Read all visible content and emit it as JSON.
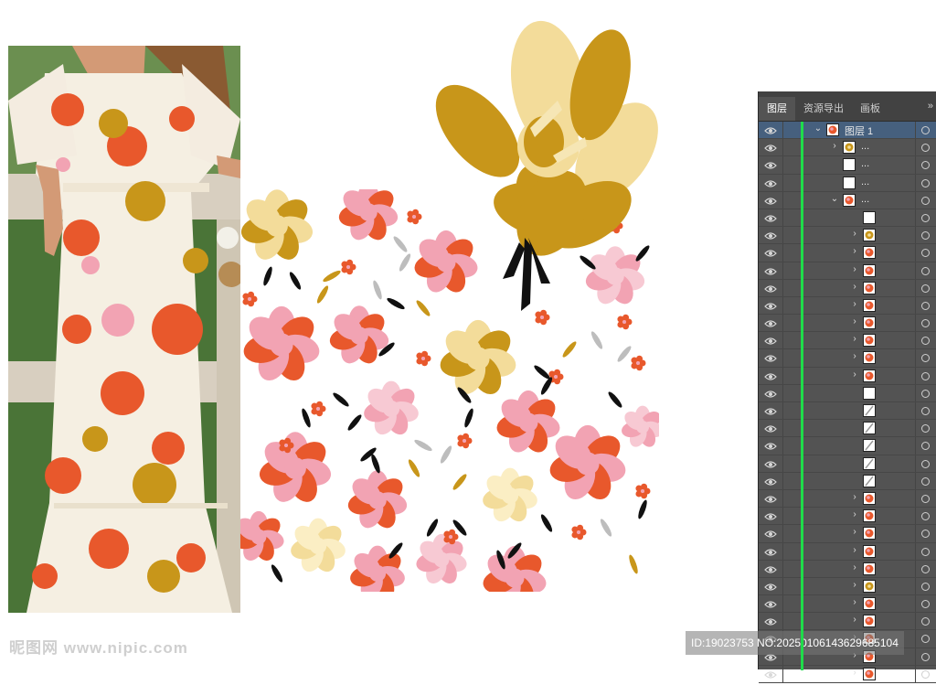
{
  "panel": {
    "tabs": [
      {
        "label": "图层"
      },
      {
        "label": "资源导出"
      },
      {
        "label": "画板"
      }
    ],
    "more_glyph": "»",
    "layers": [
      {
        "indent": 0,
        "arrow": "⌄",
        "name": "图层 1",
        "thumb": "flower",
        "selected": true
      },
      {
        "indent": 1,
        "arrow": "›",
        "name": "...",
        "thumb": "gold"
      },
      {
        "indent": 1,
        "arrow": "",
        "name": "...",
        "thumb": "blank"
      },
      {
        "indent": 1,
        "arrow": "",
        "name": "...",
        "thumb": "blank"
      },
      {
        "indent": 1,
        "arrow": "⌄",
        "name": "...",
        "thumb": "flower"
      },
      {
        "indent": 2,
        "arrow": "",
        "name": "",
        "thumb": "blank"
      },
      {
        "indent": 2,
        "arrow": "›",
        "name": "",
        "thumb": "gold"
      },
      {
        "indent": 2,
        "arrow": "›",
        "name": "",
        "thumb": "flower"
      },
      {
        "indent": 2,
        "arrow": "›",
        "name": "",
        "thumb": "flower"
      },
      {
        "indent": 2,
        "arrow": "›",
        "name": "",
        "thumb": "flower"
      },
      {
        "indent": 2,
        "arrow": "›",
        "name": "",
        "thumb": "flower"
      },
      {
        "indent": 2,
        "arrow": "›",
        "name": "",
        "thumb": "flower"
      },
      {
        "indent": 2,
        "arrow": "›",
        "name": "",
        "thumb": "flower"
      },
      {
        "indent": 2,
        "arrow": "›",
        "name": "",
        "thumb": "flower"
      },
      {
        "indent": 2,
        "arrow": "›",
        "name": "",
        "thumb": "flower"
      },
      {
        "indent": 2,
        "arrow": "",
        "name": "",
        "thumb": "blank"
      },
      {
        "indent": 2,
        "arrow": "",
        "name": "",
        "thumb": "stroke"
      },
      {
        "indent": 2,
        "arrow": "",
        "name": "",
        "thumb": "stroke"
      },
      {
        "indent": 2,
        "arrow": "",
        "name": "",
        "thumb": "stroke"
      },
      {
        "indent": 2,
        "arrow": "",
        "name": "",
        "thumb": "stroke"
      },
      {
        "indent": 2,
        "arrow": "",
        "name": "",
        "thumb": "stroke"
      },
      {
        "indent": 2,
        "arrow": "›",
        "name": "",
        "thumb": "flower"
      },
      {
        "indent": 2,
        "arrow": "›",
        "name": "",
        "thumb": "flower"
      },
      {
        "indent": 2,
        "arrow": "›",
        "name": "",
        "thumb": "flower"
      },
      {
        "indent": 2,
        "arrow": "›",
        "name": "",
        "thumb": "flower"
      },
      {
        "indent": 2,
        "arrow": "›",
        "name": "",
        "thumb": "flower"
      },
      {
        "indent": 2,
        "arrow": "›",
        "name": "",
        "thumb": "gold"
      },
      {
        "indent": 2,
        "arrow": "›",
        "name": "",
        "thumb": "flower"
      },
      {
        "indent": 2,
        "arrow": "›",
        "name": "",
        "thumb": "flower"
      },
      {
        "indent": 2,
        "arrow": "›",
        "name": "",
        "thumb": "flower"
      },
      {
        "indent": 2,
        "arrow": "›",
        "name": "",
        "thumb": "flower"
      },
      {
        "indent": 2,
        "arrow": "›",
        "name": "",
        "thumb": "flower"
      }
    ]
  },
  "watermark": {
    "left": "昵图网 www.nipic.com",
    "right": "ID:19023753 NO:20250106143629685104"
  },
  "colors": {
    "orange": "#e8582c",
    "gold": "#c8961a",
    "pale_gold": "#f3dc9a",
    "pink": "#f2a3b3",
    "panel_bg": "#535353",
    "selection": "#46607e",
    "green_bar": "#1fdc4a"
  }
}
